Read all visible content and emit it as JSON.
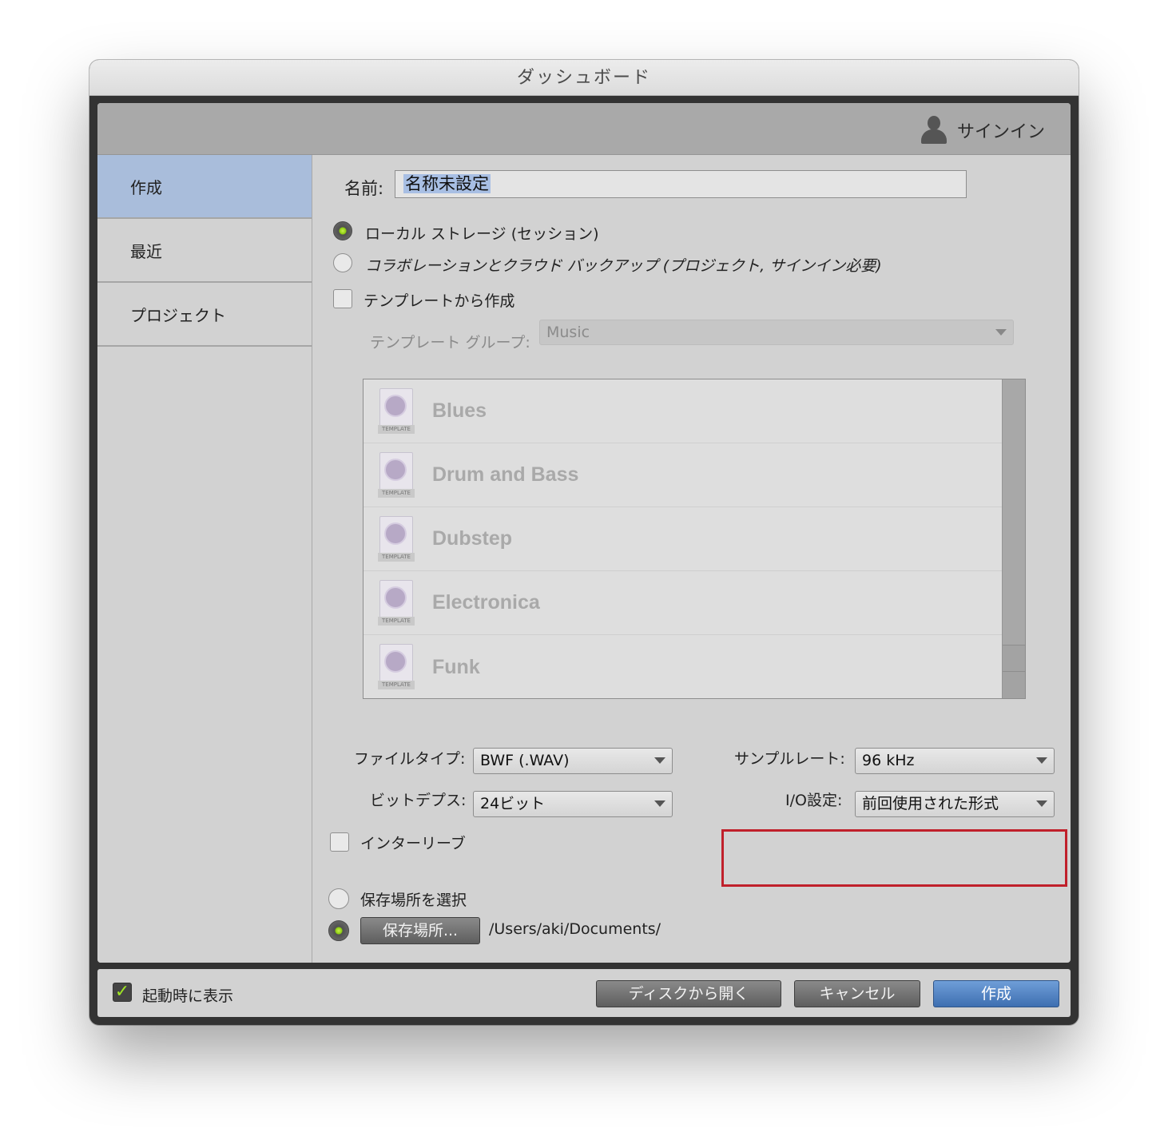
{
  "window": {
    "title": "ダッシュボード"
  },
  "header": {
    "signin_label": "サインイン"
  },
  "sidebar": {
    "items": [
      {
        "label": "作成",
        "active": true
      },
      {
        "label": "最近",
        "active": false
      },
      {
        "label": "プロジェクト",
        "active": false
      }
    ]
  },
  "form": {
    "name_label": "名前:",
    "name_value": "名称未設定",
    "storage_local_label": "ローカル ストレージ (セッション)",
    "storage_cloud_label": "コラボレーションとクラウド バックアップ (プロジェクト, サインイン必要)",
    "template_checkbox_label": "テンプレートから作成",
    "template_group_label": "テンプレート グループ:",
    "template_group_value": "Music",
    "template_tag": "TEMPLATE",
    "templates": [
      "Blues",
      "Drum and Bass",
      "Dubstep",
      "Electronica",
      "Funk"
    ],
    "file_type_label": "ファイルタイプ:",
    "file_type_value": "BWF (.WAV)",
    "sample_rate_label": "サンプルレート:",
    "sample_rate_value": "96 kHz",
    "bit_depth_label": "ビットデプス:",
    "bit_depth_value": "24ビット",
    "io_label": "I/O設定:",
    "io_value": "前回使用された形式",
    "interleave_label": "インターリーブ",
    "choose_location_label": "保存場所を選択",
    "location_button": "保存場所...",
    "location_path": "/Users/aki/Documents/"
  },
  "footer": {
    "show_on_startup_label": "起動時に表示",
    "open_from_disk": "ディスクから開く",
    "cancel": "キャンセル",
    "create": "作成"
  },
  "colors": {
    "highlight_box": "#c0202b",
    "primary_button": "#4f82c4",
    "sidebar_active": "#a9bddb"
  }
}
